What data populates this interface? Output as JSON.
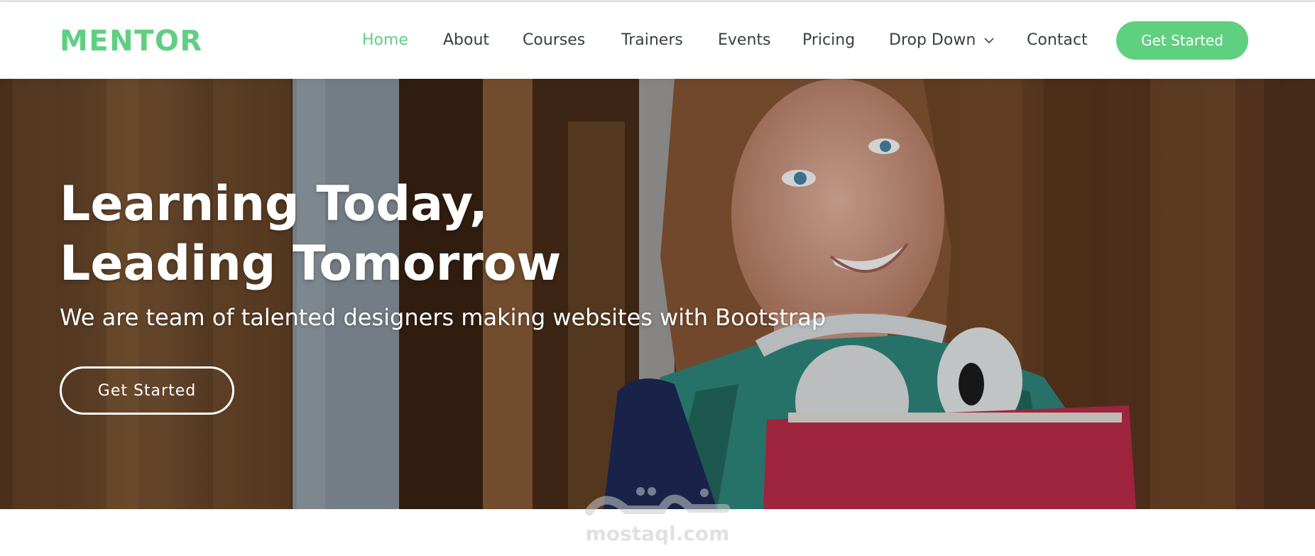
{
  "brand": {
    "name": "MENTOR",
    "color": "#5fcf80"
  },
  "nav": {
    "items": [
      {
        "label": "Home",
        "active": true
      },
      {
        "label": "About"
      },
      {
        "label": "Courses"
      },
      {
        "label": "Trainers"
      },
      {
        "label": "Events"
      },
      {
        "label": "Pricing"
      },
      {
        "label": "Drop Down",
        "icon": "chevron-down-icon"
      },
      {
        "label": "Contact"
      }
    ],
    "cta_label": "Get Started"
  },
  "hero": {
    "title_line1": "Learning Today,",
    "title_line2": "Leading Tomorrow",
    "subtitle": "We are team of talented designers making websites with Bootstrap",
    "button_label": "Get Started",
    "image": "student-with-headphones-photo"
  },
  "watermark": {
    "text": "mostaql.com",
    "logo": "mostaql-arabic-logo"
  },
  "colors": {
    "accent": "#5fcf80",
    "nav_text": "#37423b",
    "hero_text": "#ffffff"
  }
}
